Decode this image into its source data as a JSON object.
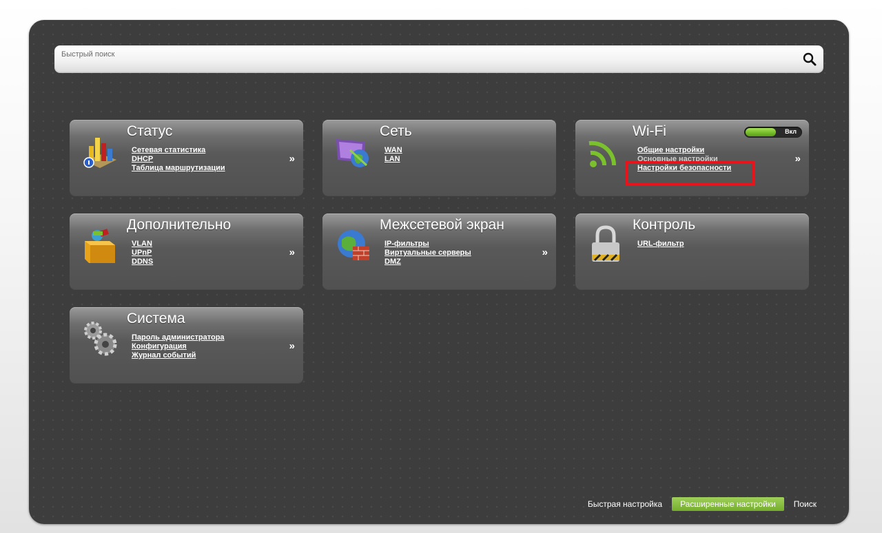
{
  "search": {
    "placeholder": "Быстрый поиск"
  },
  "cards": {
    "status": {
      "title": "Статус",
      "links": [
        "Сетевая статистика",
        "DHCP",
        "Таблица маршрутизации"
      ],
      "arrow": "»"
    },
    "network": {
      "title": "Сеть",
      "links": [
        "WAN",
        "LAN"
      ]
    },
    "wifi": {
      "title": "Wi-Fi",
      "links": [
        "Общие настройки",
        "Основные настройки",
        "Настройки безопасности"
      ],
      "toggle_label": "Вкл",
      "toggle_state": "on",
      "arrow": "»"
    },
    "advanced": {
      "title": "Дополнительно",
      "links": [
        "VLAN",
        "UPnP",
        "DDNS"
      ],
      "arrow": "»"
    },
    "firewall": {
      "title": "Межсетевой экран",
      "links": [
        "IP-фильтры",
        "Виртуальные серверы",
        "DMZ"
      ],
      "arrow": "»"
    },
    "control": {
      "title": "Контроль",
      "links": [
        "URL-фильтр"
      ]
    },
    "system": {
      "title": "Система",
      "links": [
        "Пароль администратора",
        "Конфигурация",
        "Журнал событий"
      ],
      "arrow": "»"
    }
  },
  "footer": {
    "quick_setup": "Быстрая настройка",
    "advanced_settings": "Расширенные настройки",
    "search": "Поиск"
  },
  "icons": {
    "status": "bar-chart-icon",
    "network": "network-globe-icon",
    "wifi": "wifi-icon",
    "advanced": "toolbox-icon",
    "firewall": "firewall-icon",
    "control": "padlock-icon",
    "system": "gears-icon",
    "search": "magnifier-icon"
  },
  "colors": {
    "accent_green": "#7bc12d",
    "highlight_red": "#e8141c",
    "panel_bg": "#3d3d3d"
  }
}
